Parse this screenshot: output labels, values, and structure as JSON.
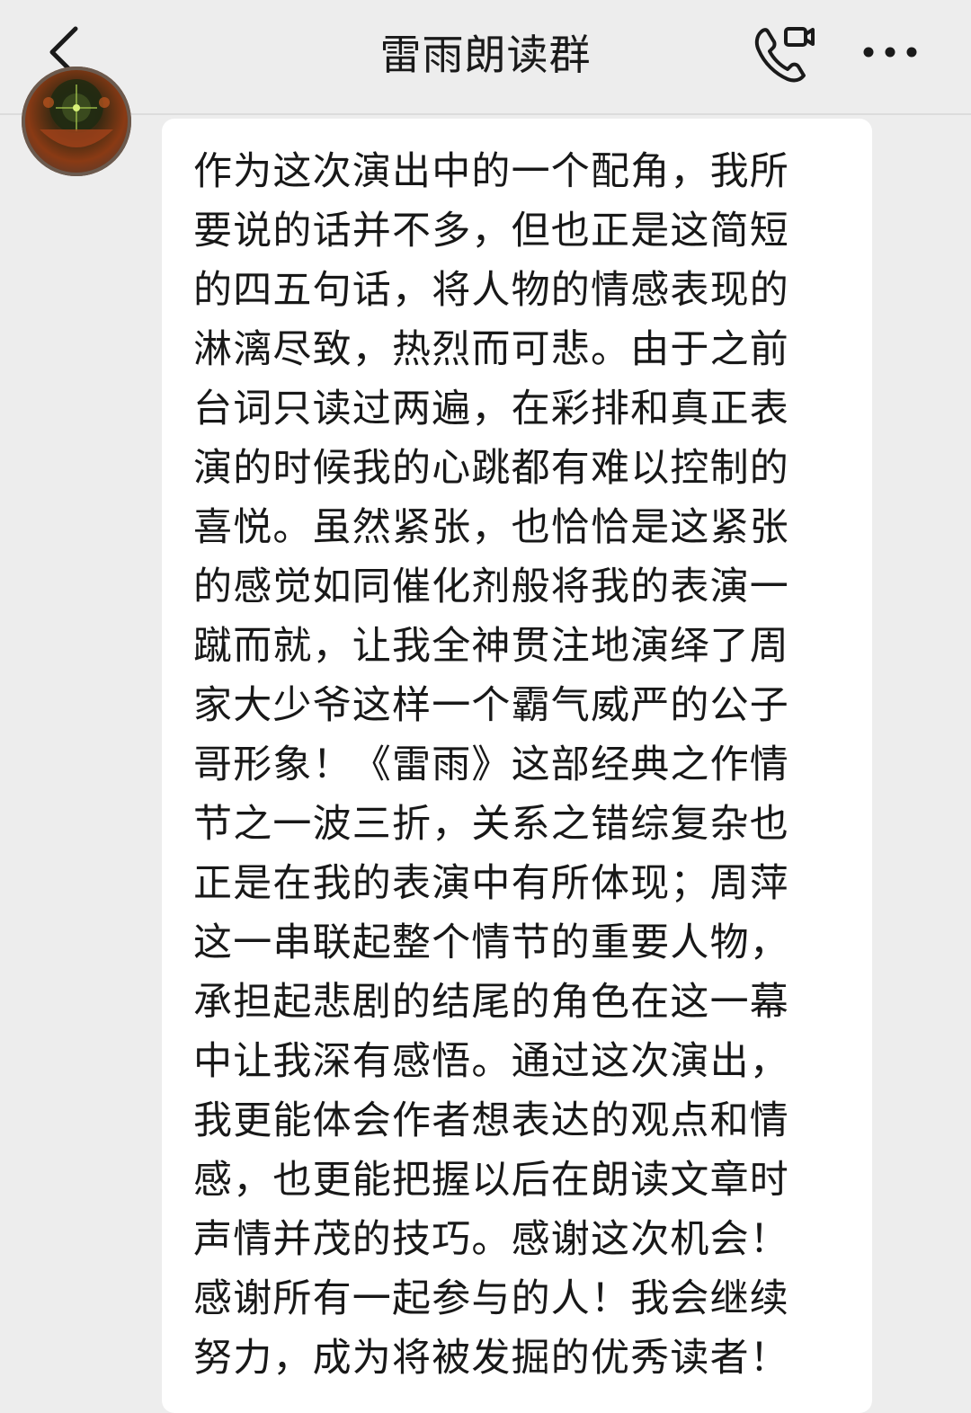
{
  "header": {
    "title": "雷雨朗读群",
    "back_icon": "chevron-left-icon",
    "call_icon": "phone-video-icon",
    "more_icon": "more-dots-icon"
  },
  "message": {
    "sender_avatar": "avatar-image",
    "text": "作为这次演出中的一个配角，我所\n要说的话并不多，但也正是这简短\n的四五句话，将人物的情感表现的\n淋漓尽致，热烈而可悲。由于之前\n台词只读过两遍，在彩排和真正表\n演的时候我的心跳都有难以控制的\n喜悦。虽然紧张，也恰恰是这紧张\n的感觉如同催化剂般将我的表演一\n蹴而就，让我全神贯注地演绎了周\n家大少爷这样一个霸气威严的公子\n哥形象！《雷雨》这部经典之作情\n节之一波三折，关系之错综复杂也\n正是在我的表演中有所体现；周萍\n这一串联起整个情节的重要人物，\n承担起悲剧的结尾的角色在这一幕\n中让我深有感悟。通过这次演出，\n我更能体会作者想表达的观点和情\n感，也更能把握以后在朗读文章时\n声情并茂的技巧。感谢这次机会！\n感谢所有一起参与的人！我会继续\n努力，成为将被发掘的优秀读者！"
  }
}
